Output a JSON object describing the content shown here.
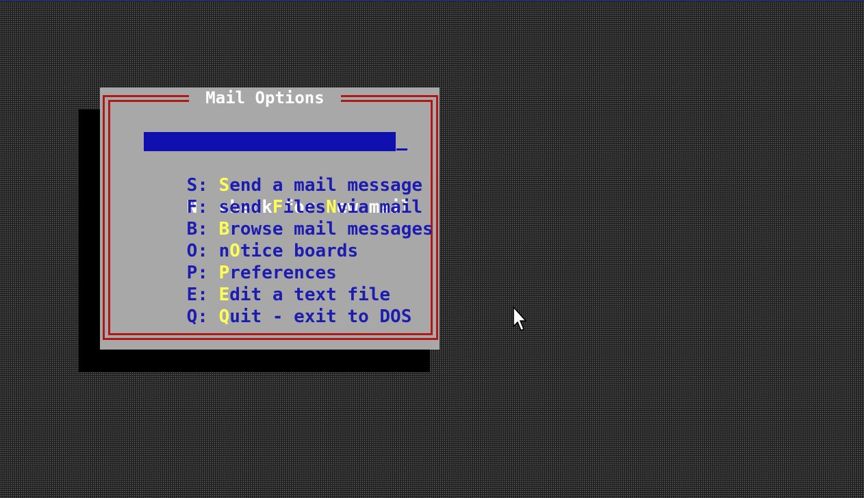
{
  "dialog": {
    "title": "Mail Options",
    "items": [
      {
        "key": "N:",
        "pre": "check for ",
        "hotkey": "N",
        "post": "ew mail",
        "selected": true
      },
      {
        "key": "S:",
        "pre": "",
        "hotkey": "S",
        "post": "end a mail message",
        "selected": false
      },
      {
        "key": "F:",
        "pre": "send ",
        "hotkey": "F",
        "post": "iles via mail",
        "selected": false
      },
      {
        "key": "B:",
        "pre": "",
        "hotkey": "B",
        "post": "rowse mail messages",
        "selected": false
      },
      {
        "key": "O:",
        "pre": "n",
        "hotkey": "O",
        "post": "tice boards",
        "selected": false
      },
      {
        "key": "P:",
        "pre": "",
        "hotkey": "P",
        "post": "references",
        "selected": false
      },
      {
        "key": "E:",
        "pre": "",
        "hotkey": "E",
        "post": "dit a text file",
        "selected": false
      },
      {
        "key": "Q:",
        "pre": "",
        "hotkey": "Q",
        "post": "uit - exit to DOS",
        "selected": false
      }
    ]
  },
  "colors": {
    "desktop": "#202020",
    "dialog_bg": "#a8a8a8",
    "frame": "#b01818",
    "text": "#1c1cb0",
    "selection": "#1010b0",
    "hotkey": "#ffff55",
    "title": "#ffffff"
  },
  "icons": {
    "pointer": "mouse-pointer-icon"
  }
}
